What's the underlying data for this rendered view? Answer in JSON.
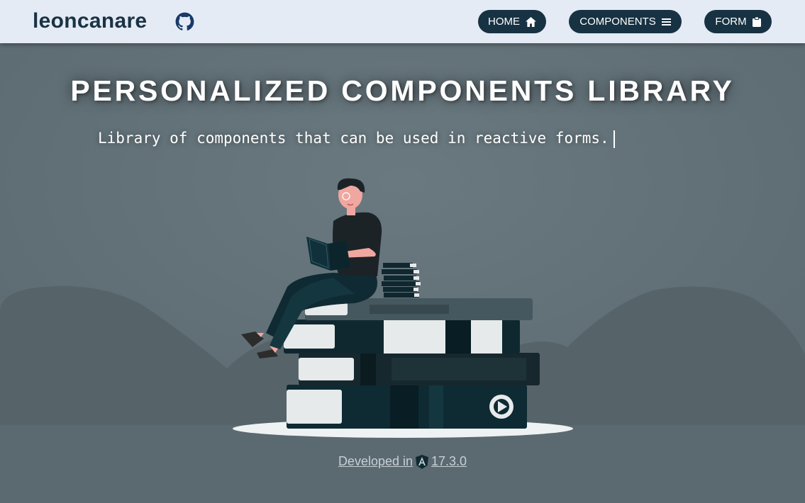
{
  "navbar": {
    "brand": "leoncanare",
    "home_label": "HOME",
    "components_label": "COMPONENTS",
    "form_label": "FORM",
    "icons": {
      "brand": "github-icon",
      "home": "home-icon",
      "components": "menu-icon",
      "form": "clipboard-icon"
    }
  },
  "hero": {
    "title": "PERSONALIZED COMPONENTS LIBRARY",
    "subtitle": "Library of components that can be used in reactive forms."
  },
  "footer": {
    "prefix": "Developed in",
    "version": "17.3.0",
    "icon": "angular-icon"
  },
  "colors": {
    "navbar_bg": "#e4ebf5",
    "brand_text": "#1a3344",
    "button_bg": "#173243",
    "page_bg": "#5d6c73",
    "book_dark": "#0f2a33"
  }
}
